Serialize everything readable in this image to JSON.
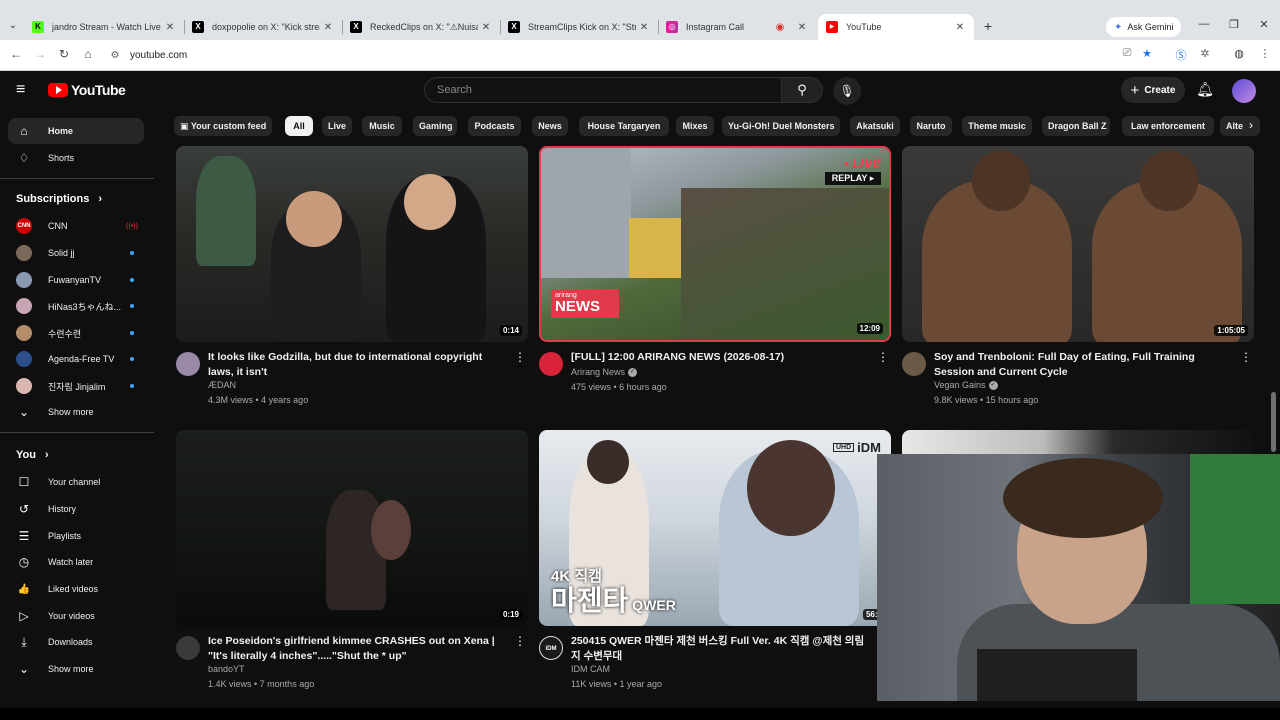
{
  "browser": {
    "tabs": [
      {
        "label": "jandro Stream - Watch Live on",
        "favicon_color": "#53fc18",
        "favicon_glyph": "K"
      },
      {
        "label": "doxpopolie on X: \"Kick streame",
        "favicon_color": "#000000",
        "favicon_glyph": "X"
      },
      {
        "label": "ReckedClips on X: \"⚠Nuisance",
        "favicon_color": "#000000",
        "favicon_glyph": "X"
      },
      {
        "label": "StreamClips Kick on X: \"Streame",
        "favicon_color": "#000000",
        "favicon_glyph": "X"
      },
      {
        "label": "Instagram Call",
        "favicon_color": "#d6249f",
        "favicon_glyph": "◎"
      },
      {
        "label": "YouTube",
        "favicon_color": "#ff0000",
        "favicon_glyph": "▶"
      }
    ],
    "new_tab": "+",
    "gemini_label": "Ask Gemini",
    "url": "youtube.com"
  },
  "masthead": {
    "logo_text": "YouTube",
    "search_placeholder": "Search",
    "create_label": "Create"
  },
  "sidebar": {
    "main": [
      {
        "label": "Home",
        "icon": "home-icon",
        "glyph": "⌂"
      },
      {
        "label": "Shorts",
        "icon": "shorts-icon",
        "glyph": "♢"
      }
    ],
    "subscriptions_header": "Subscriptions",
    "subscriptions": [
      {
        "label": "CNN",
        "avatar_color": "#cc0000",
        "avatar_text": "CNN",
        "status": "live"
      },
      {
        "label": "Solid jj",
        "avatar_color": "#7a6a5a",
        "avatar_text": "",
        "status": "new"
      },
      {
        "label": "FuwanyanTV",
        "avatar_color": "#8a9ab5",
        "avatar_text": "",
        "status": "new"
      },
      {
        "label": "HiNas3ちゃんね...",
        "avatar_color": "#c7a5b5",
        "avatar_text": "",
        "status": "new"
      },
      {
        "label": "수련수련",
        "avatar_color": "#b38c6a",
        "avatar_text": "",
        "status": "new"
      },
      {
        "label": "Agenda-Free TV",
        "avatar_color": "#2d4f8a",
        "avatar_text": "",
        "status": "new"
      },
      {
        "label": "진자림 Jinjalim",
        "avatar_color": "#d9b8b0",
        "avatar_text": "",
        "status": "new"
      }
    ],
    "subs_show_more": "Show more",
    "you_header": "You",
    "you": [
      {
        "label": "Your channel",
        "icon": "your-channel-icon",
        "glyph": "☐"
      },
      {
        "label": "History",
        "icon": "history-icon",
        "glyph": "↺"
      },
      {
        "label": "Playlists",
        "icon": "playlists-icon",
        "glyph": "☰"
      },
      {
        "label": "Watch later",
        "icon": "watch-later-icon",
        "glyph": "◷"
      },
      {
        "label": "Liked videos",
        "icon": "liked-videos-icon",
        "glyph": "👍"
      },
      {
        "label": "Your videos",
        "icon": "your-videos-icon",
        "glyph": "▷"
      },
      {
        "label": "Downloads",
        "icon": "downloads-icon",
        "glyph": "⤓"
      }
    ],
    "you_show_more": "Show more"
  },
  "chips": [
    "Your custom feed",
    "All",
    "Live",
    "Music",
    "Gaming",
    "Podcasts",
    "News",
    "House Targaryen",
    "Mixes",
    "Yu-Gi-Oh! Duel Monsters",
    "Akatsuki",
    "Naruto",
    "Theme music",
    "Dragon Ball Z",
    "Law enforcement",
    "Alte"
  ],
  "videos": [
    {
      "title": "It looks like Godzilla, but due to international copyright laws, it isn't",
      "channel": "ÆDAN",
      "verified": false,
      "stats": "4.3M views • 4 years ago",
      "duration": "0:14",
      "avatar_color": "#9a8aa8"
    },
    {
      "title": "[FULL] 12:00 ARIRANG NEWS (2026-08-17)",
      "channel": "Arirang News",
      "verified": true,
      "stats": "475 views • 6 hours ago",
      "duration": "12:09",
      "avatar_color": "#d9233a",
      "live_label": "• LIVE",
      "replay_label": "REPLAY ▸",
      "news_small": "arirang",
      "news_big": "NEWS"
    },
    {
      "title": "Soy and Trenboloni: Full Day of Eating, Full Training Session and Current Cycle",
      "channel": "Vegan Gains",
      "verified": true,
      "stats": "9.8K views • 15 hours ago",
      "duration": "1:05:05",
      "avatar_color": "#6b5a48"
    },
    {
      "title": "Ice Poseidon's girlfriend kimmee CRASHES out on Xena | \"It's literally 4 inches\".....\"Shut the * up\"",
      "channel": "bandoYT",
      "verified": false,
      "stats": "1.4K views • 7 months ago",
      "duration": "0:19",
      "avatar_color": "#3a3a3a"
    },
    {
      "title": "250415 QWER 마젠타 제천 버스킹 Full Ver. 4K 직캠 @제천 의림지 수변무대",
      "channel": "IDM CAM",
      "verified": false,
      "stats": "11K views • 1 year ago",
      "duration": "56:0",
      "avatar_color": "#1a1a1a",
      "avatar_text": "iDM",
      "overlay_small": "4K 직캠",
      "overlay_big": "마젠타",
      "overlay_group": "QWER",
      "uhd": "UHD",
      "idm": "iDM"
    }
  ]
}
